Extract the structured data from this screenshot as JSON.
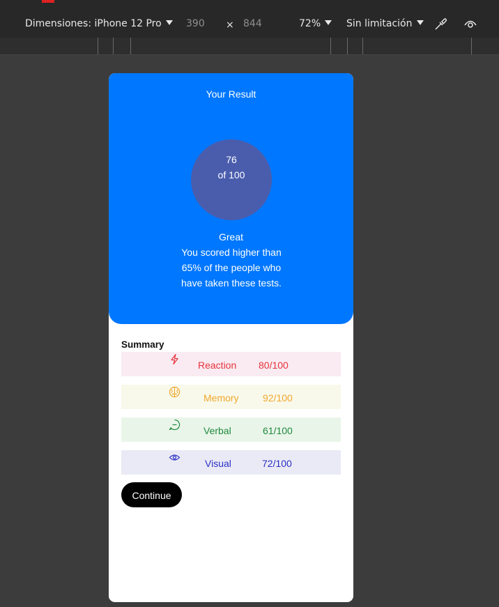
{
  "devtools": {
    "device_label": "Dimensiones: iPhone 12 Pro",
    "width": "390",
    "times": "×",
    "height": "844",
    "zoom": "72%",
    "throttle": "Sin limitación"
  },
  "result": {
    "title": "Your Result",
    "score": "76",
    "out_of": "of 100",
    "verdict": "Great",
    "blurb": "You scored higher than 65% of the people who have taken these tests."
  },
  "summary": {
    "title": "Summary",
    "items": [
      {
        "label": "Reaction",
        "score": "80/100",
        "icon": "lightning-icon",
        "color": "#e8323c",
        "bg": "#f9ebf1"
      },
      {
        "label": "Memory",
        "score": "92/100",
        "icon": "brain-icon",
        "color": "#f2a72e",
        "bg": "#f8f9ea"
      },
      {
        "label": "Verbal",
        "score": "61/100",
        "icon": "chat-icon",
        "color": "#1f8a3d",
        "bg": "#eaf5ea"
      },
      {
        "label": "Visual",
        "score": "72/100",
        "icon": "eye-icon",
        "color": "#2a2fc4",
        "bg": "#eaeaf6"
      }
    ]
  },
  "continue_label": "Continue",
  "colors": {
    "result_bg": "#0077ff",
    "circle_bg": "#4a5dad"
  }
}
